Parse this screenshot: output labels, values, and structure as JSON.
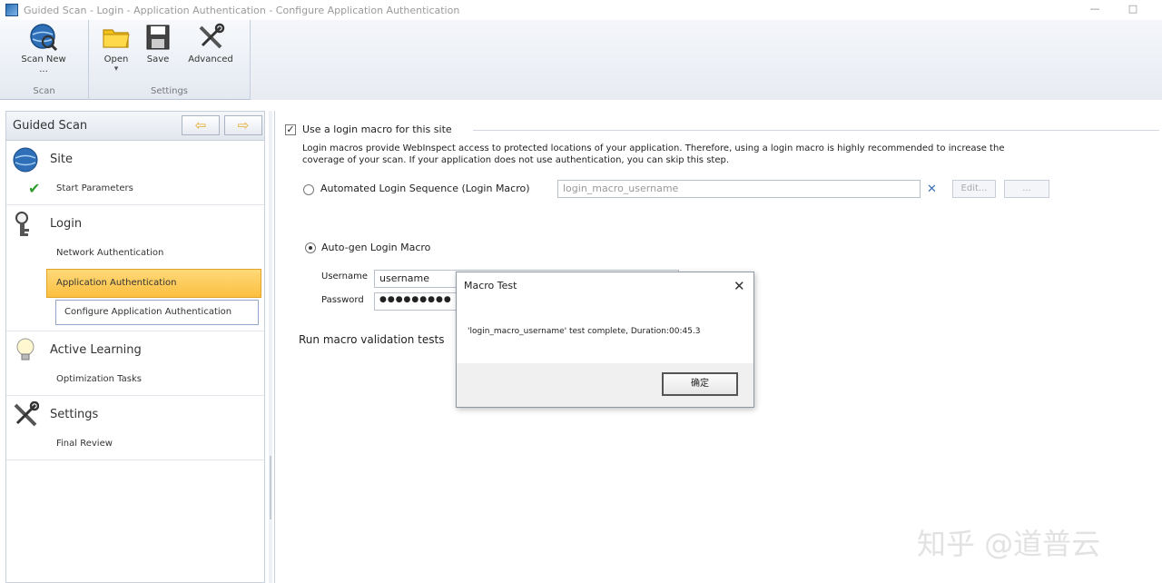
{
  "window": {
    "title": "Guided Scan - Login - Application Authentication - Configure Application Authentication",
    "minimize": "—",
    "maximize": "□"
  },
  "ribbon": {
    "scan_group_label": "Scan",
    "settings_group_label": "Settings",
    "scan_new_label": "Scan New ...",
    "open_label": "Open",
    "open_dropdown": "▾",
    "save_label": "Save",
    "advanced_label": "Advanced"
  },
  "guided_scan": {
    "title": "Guided Scan",
    "back_arrow": "⇦",
    "forward_arrow": "⇨",
    "sections": {
      "site": {
        "title": "Site",
        "steps": [
          "Start Parameters"
        ]
      },
      "login": {
        "title": "Login",
        "steps": [
          "Network Authentication",
          "Application Authentication",
          "Configure Application Authentication"
        ]
      },
      "active_learning": {
        "title": "Active Learning",
        "steps": [
          "Optimization Tasks"
        ]
      },
      "settings": {
        "title": "Settings",
        "steps": [
          "Final Review"
        ]
      }
    },
    "check_mark": "✔"
  },
  "main": {
    "use_login_macro_label": "Use a login macro for this site",
    "use_login_macro_checked": "✓",
    "description_line1": "Login macros provide WebInspect access to protected locations of your application.  Therefore, using a login macro is highly recommended to increase the",
    "description_line2": "coverage of your scan. If your application does not use authentication, you can skip this step.",
    "automated_login_label": "Automated Login Sequence (Login Macro)",
    "macro_field_value": "login_macro_username",
    "clear_icon": "✕",
    "edit_button": "Edit...",
    "browse_button": "...",
    "autogen_label": "Auto-gen Login Macro",
    "username_label": "Username",
    "username_value": "username",
    "password_label": "Password",
    "password_value": "●●●●●●●●●",
    "run_validation_label": "Run macro validation tests"
  },
  "dialog": {
    "title": "Macro Test",
    "close": "✕",
    "message": "'login_macro_username' test complete, Duration:00:45.3",
    "ok_button": "确定"
  },
  "watermark": "知乎 @道普云",
  "colors": {
    "active_step": "#fbbf3f",
    "check": "#2f9e2f",
    "clear_icon": "#3a6fb3"
  }
}
